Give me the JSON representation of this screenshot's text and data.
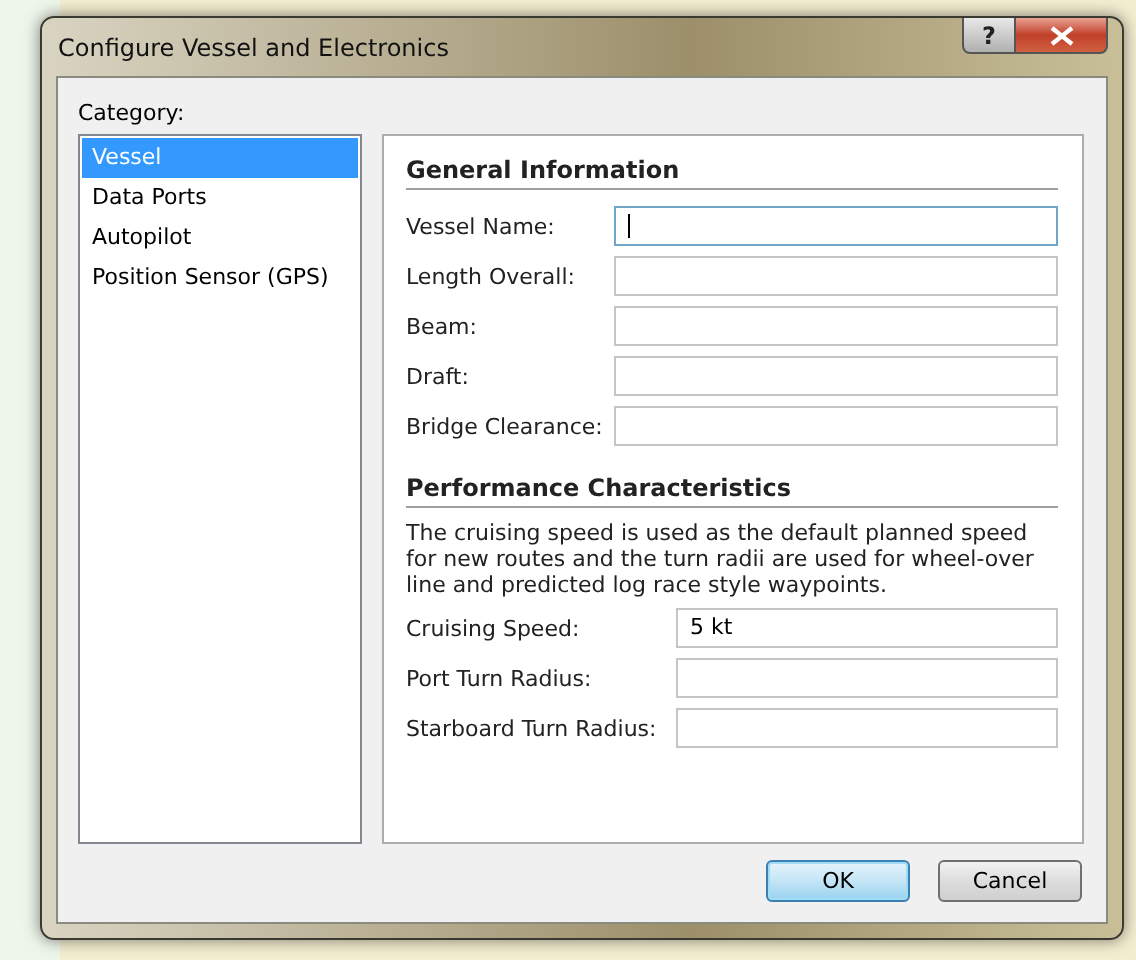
{
  "window": {
    "title": "Configure Vessel and Electronics",
    "help": "?"
  },
  "category": {
    "label": "Category:",
    "items": [
      {
        "label": "Vessel",
        "selected": true
      },
      {
        "label": "Data Ports",
        "selected": false
      },
      {
        "label": "Autopilot",
        "selected": false
      },
      {
        "label": "Position Sensor (GPS)",
        "selected": false
      }
    ]
  },
  "general": {
    "title": "General Information",
    "fields": [
      {
        "label": "Vessel Name:",
        "focused": true
      },
      {
        "label": "Length Overall:",
        "focused": false
      },
      {
        "label": "Beam:",
        "focused": false
      },
      {
        "label": "Draft:",
        "focused": false
      },
      {
        "label": "Bridge Clearance:",
        "focused": false
      }
    ]
  },
  "performance": {
    "title": "Performance Characteristics",
    "description": "The cruising speed is used as the default planned speed for new routes and the turn radii are used for wheel-over line and predicted log race style waypoints.",
    "fields": [
      {
        "label": "Cruising Speed:",
        "value": "5 kt",
        "focused": false
      },
      {
        "label": "Port Turn Radius:",
        "focused": false
      },
      {
        "label": "Starboard Turn Radius:",
        "focused": false
      }
    ]
  },
  "buttons": [
    {
      "label": "OK",
      "default": true
    },
    {
      "label": "Cancel",
      "default": false
    }
  ]
}
